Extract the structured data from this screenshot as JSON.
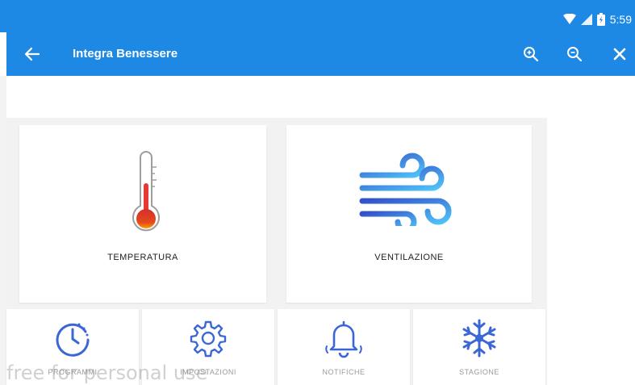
{
  "status_bar": {
    "time": "5:59",
    "icons": [
      "wifi-icon",
      "signal-icon",
      "battery-icon"
    ]
  },
  "app_bar": {
    "title": "Integra Benessere",
    "back_icon": "arrow-left-icon",
    "actions": [
      "zoom-in-icon",
      "zoom-out-icon",
      "close-icon"
    ]
  },
  "tiles": [
    {
      "label": "TEMPERATURA",
      "icon": "thermometer-icon"
    },
    {
      "label": "VENTILAZIONE",
      "icon": "wind-icon"
    }
  ],
  "small_tiles": [
    {
      "label": "PROGRAMMI",
      "icon": "clock-icon"
    },
    {
      "label": "IMPOSTAZIONI",
      "icon": "gear-icon"
    },
    {
      "label": "NOTIFICHE",
      "icon": "bell-icon"
    },
    {
      "label": "STAGIONE",
      "icon": "snowflake-icon"
    }
  ],
  "watermark": "free for personal use",
  "colors": {
    "primary": "#1e88e5",
    "accent_blue": "#3b67d6",
    "thermo_red": "#e53935",
    "thermo_orange": "#ff9800"
  }
}
